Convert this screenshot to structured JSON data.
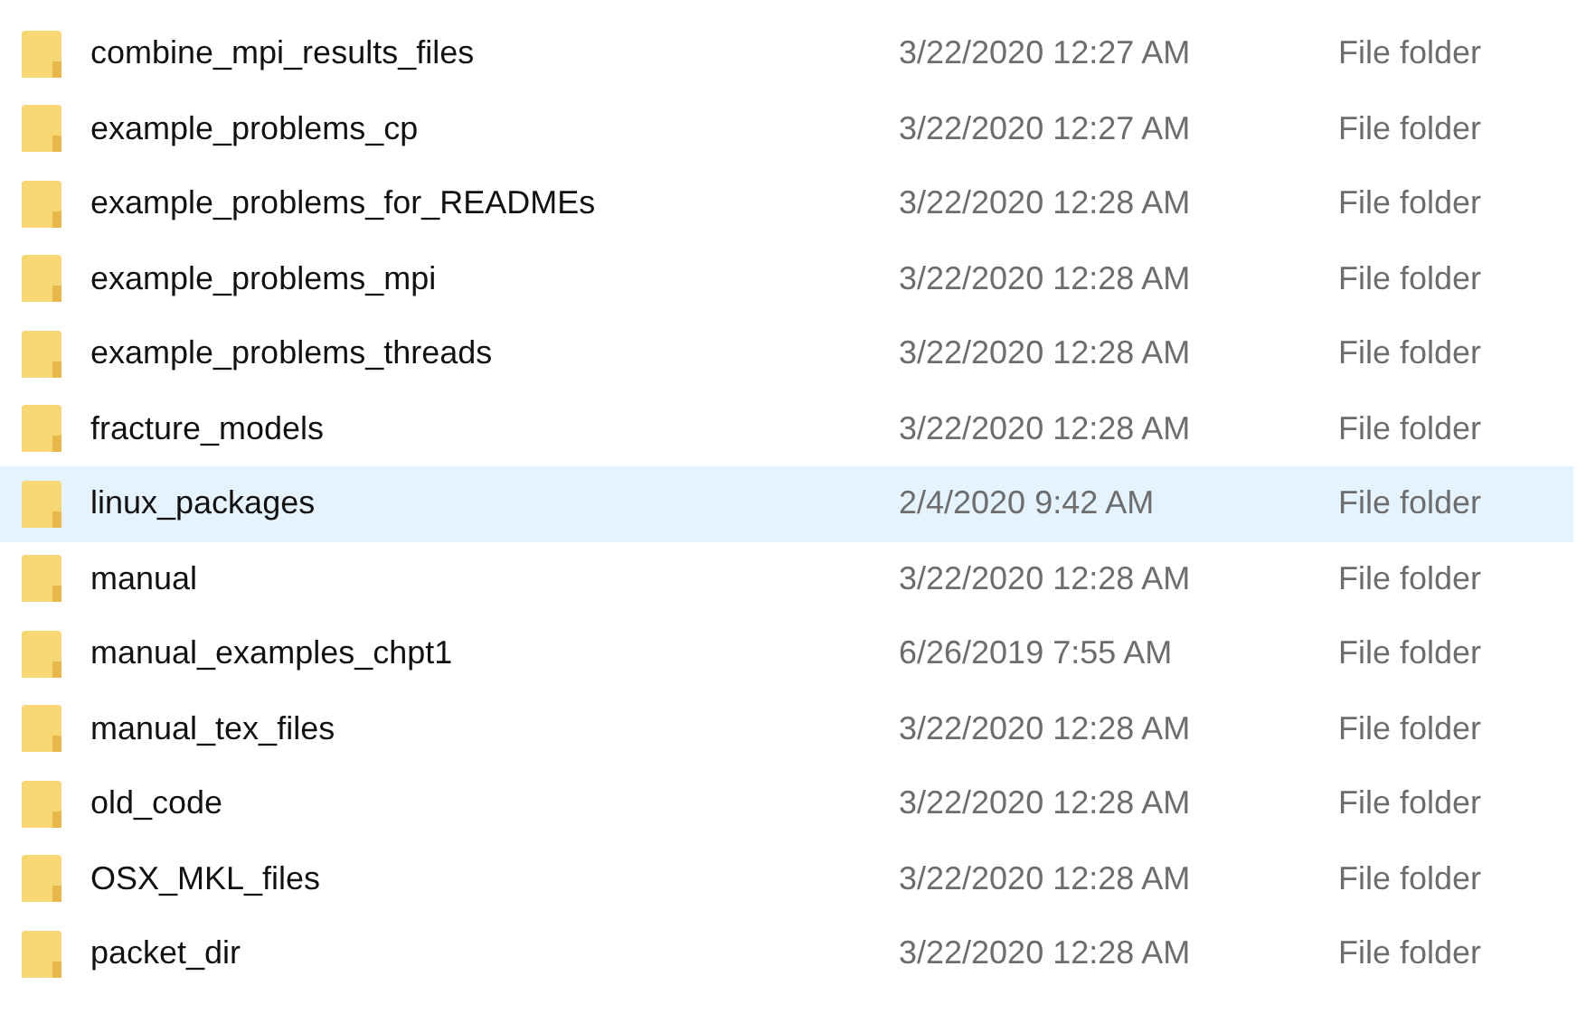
{
  "files": [
    {
      "name": "combine_mpi_results_files",
      "date": "3/22/2020 12:27 AM",
      "type": "File folder",
      "selected": false
    },
    {
      "name": "example_problems_cp",
      "date": "3/22/2020 12:27 AM",
      "type": "File folder",
      "selected": false
    },
    {
      "name": "example_problems_for_READMEs",
      "date": "3/22/2020 12:28 AM",
      "type": "File folder",
      "selected": false
    },
    {
      "name": "example_problems_mpi",
      "date": "3/22/2020 12:28 AM",
      "type": "File folder",
      "selected": false
    },
    {
      "name": "example_problems_threads",
      "date": "3/22/2020 12:28 AM",
      "type": "File folder",
      "selected": false
    },
    {
      "name": "fracture_models",
      "date": "3/22/2020 12:28 AM",
      "type": "File folder",
      "selected": false
    },
    {
      "name": "linux_packages",
      "date": "2/4/2020 9:42 AM",
      "type": "File folder",
      "selected": true
    },
    {
      "name": "manual",
      "date": "3/22/2020 12:28 AM",
      "type": "File folder",
      "selected": false
    },
    {
      "name": "manual_examples_chpt1",
      "date": "6/26/2019 7:55 AM",
      "type": "File folder",
      "selected": false
    },
    {
      "name": "manual_tex_files",
      "date": "3/22/2020 12:28 AM",
      "type": "File folder",
      "selected": false
    },
    {
      "name": "old_code",
      "date": "3/22/2020 12:28 AM",
      "type": "File folder",
      "selected": false
    },
    {
      "name": "OSX_MKL_files",
      "date": "3/22/2020 12:28 AM",
      "type": "File folder",
      "selected": false
    },
    {
      "name": "packet_dir",
      "date": "3/22/2020 12:28 AM",
      "type": "File folder",
      "selected": false
    }
  ]
}
